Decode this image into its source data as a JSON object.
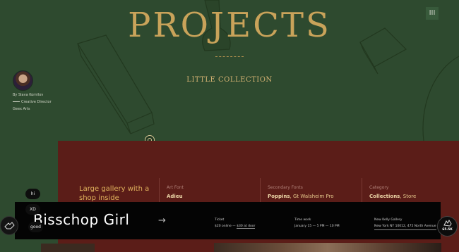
{
  "page": {
    "title": "PROJECTS",
    "subtitle": "LITTLE COLLECTION",
    "menu_icon": "III"
  },
  "author": {
    "name": "By Slava Kornilov",
    "role": "Creative Director",
    "company": "Geex Arts"
  },
  "project": {
    "heading": "Large gallery with a shop inside",
    "columns": [
      {
        "label": "Art Font",
        "value": "Adieu",
        "value_rest": ""
      },
      {
        "label": "Secondary Fonts",
        "value": "Poppins",
        "value_rest": ", Gt Walsheim Pro"
      },
      {
        "label": "Category",
        "value": "Collections",
        "value_rest": ", Store"
      }
    ],
    "name": "Bisschop Girl",
    "arrow": "→",
    "info": {
      "ticket_label": "Ticket",
      "ticket_value_a": "$20 online",
      "ticket_sep": " — ",
      "ticket_value_b": "$30 at door",
      "time_label": "Time work",
      "time_value": "January 15 — 5 PM — 10 PM",
      "gallery_label": "New Kelly Gallery",
      "gallery_value": "New York NY 10012, 475 North Avenue"
    }
  },
  "tags": [
    "hi",
    "XD",
    "good"
  ],
  "likes": "65.5K",
  "colors": {
    "green": "#2e4a2f",
    "gold": "#c9a35a",
    "maroon": "#5b1d18",
    "black": "#040404"
  }
}
